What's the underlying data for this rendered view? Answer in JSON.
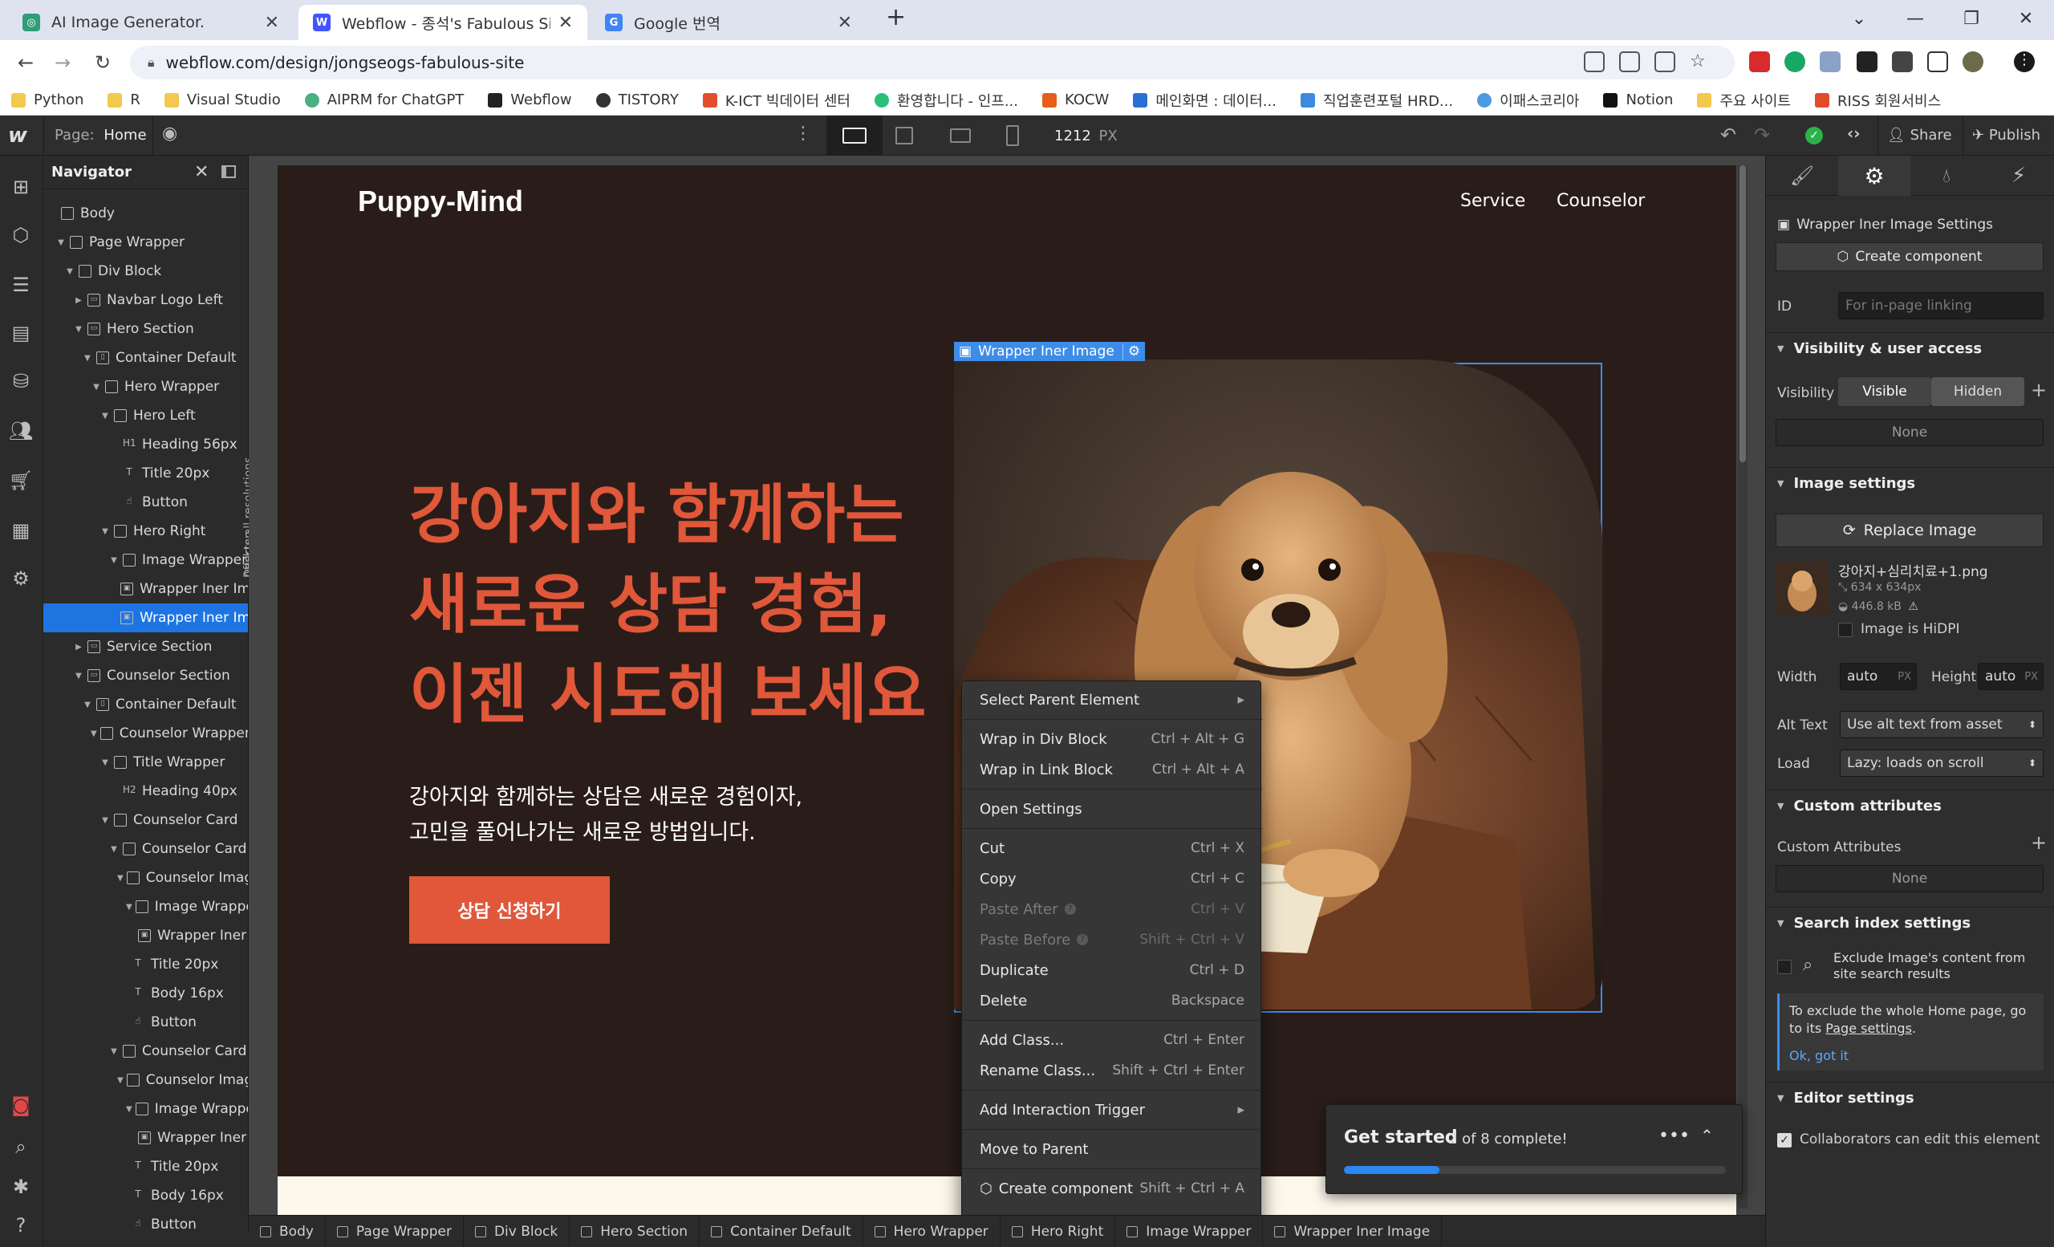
{
  "browser": {
    "tabs": [
      {
        "title": "AI Image Generator.",
        "icon_color": "#2f9e77",
        "active": false
      },
      {
        "title": "Webflow - 종석's Fabulous Site",
        "icon_color": "#4353ff",
        "active": true
      },
      {
        "title": "Google 번역",
        "icon_color": "#4285f4",
        "active": false
      }
    ],
    "url": "webflow.com/design/jongseogs-fabulous-site",
    "bookmarks": [
      "Python",
      "R",
      "Visual Studio",
      "AIPRM for ChatGPT",
      "Webflow",
      "TISTORY",
      "K-ICT 빅데이터 센터",
      "환영합니다 - 인프...",
      "KOCW",
      "메인화면 : 데이터...",
      "직업훈련포털 HRD...",
      "이패스코리아",
      "Notion",
      "주요 사이트",
      "RISS 회원서비스"
    ]
  },
  "wf_topbar": {
    "page_label": "Page:",
    "page_name": "Home",
    "width_value": "1212",
    "width_unit": "PX",
    "share": "Share",
    "publish": "Publish"
  },
  "navigator": {
    "title": "Navigator",
    "rows": [
      {
        "label": "Body",
        "depth": 0,
        "caret": "",
        "icon": "box"
      },
      {
        "label": "Page Wrapper",
        "depth": 1,
        "caret": "down",
        "icon": "box"
      },
      {
        "label": "Div Block",
        "depth": 2,
        "caret": "down",
        "icon": "box"
      },
      {
        "label": "Navbar Logo Left",
        "depth": 3,
        "caret": "right",
        "icon": "section"
      },
      {
        "label": "Hero Section",
        "depth": 3,
        "caret": "down",
        "icon": "section"
      },
      {
        "label": "Container Default",
        "depth": 4,
        "caret": "down",
        "icon": "container"
      },
      {
        "label": "Hero Wrapper",
        "depth": 5,
        "caret": "down",
        "icon": "box"
      },
      {
        "label": "Hero Left",
        "depth": 6,
        "caret": "down",
        "icon": "box"
      },
      {
        "label": "Heading 56px",
        "depth": 7,
        "caret": "",
        "icon": "H1"
      },
      {
        "label": "Title 20px",
        "depth": 7,
        "caret": "",
        "icon": "T"
      },
      {
        "label": "Button",
        "depth": 7,
        "caret": "",
        "icon": "hand"
      },
      {
        "label": "Hero Right",
        "depth": 6,
        "caret": "down",
        "icon": "box"
      },
      {
        "label": "Image Wrapper",
        "depth": 7,
        "caret": "down",
        "icon": "box"
      },
      {
        "label": "Wrapper Iner Image",
        "depth": 8,
        "caret": "",
        "icon": "img"
      },
      {
        "label": "Wrapper Iner Image",
        "depth": 8,
        "caret": "",
        "icon": "img",
        "selected": true
      },
      {
        "label": "Service Section",
        "depth": 3,
        "caret": "right",
        "icon": "section"
      },
      {
        "label": "Counselor Section",
        "depth": 3,
        "caret": "down",
        "icon": "section"
      },
      {
        "label": "Container Default",
        "depth": 4,
        "caret": "down",
        "icon": "container"
      },
      {
        "label": "Counselor Wrapper",
        "depth": 5,
        "caret": "down",
        "icon": "box"
      },
      {
        "label": "Title Wrapper",
        "depth": 6,
        "caret": "down",
        "icon": "box"
      },
      {
        "label": "Heading 40px",
        "depth": 7,
        "caret": "",
        "icon": "H2"
      },
      {
        "label": "Counselor Card",
        "depth": 6,
        "caret": "down",
        "icon": "box"
      },
      {
        "label": "Counselor Card",
        "depth": 7,
        "caret": "down",
        "icon": "box"
      },
      {
        "label": "Counselor Image",
        "depth": 8,
        "caret": "down",
        "icon": "box"
      },
      {
        "label": "Image Wrapper",
        "depth": 9,
        "caret": "down",
        "icon": "box"
      },
      {
        "label": "Wrapper Iner Image",
        "depth": 10,
        "caret": "",
        "icon": "img"
      },
      {
        "label": "Title 20px",
        "depth": 8,
        "caret": "",
        "icon": "T"
      },
      {
        "label": "Body 16px",
        "depth": 8,
        "caret": "",
        "icon": "T"
      },
      {
        "label": "Button",
        "depth": 8,
        "caret": "",
        "icon": "hand"
      },
      {
        "label": "Counselor Card",
        "depth": 7,
        "caret": "down",
        "icon": "box"
      },
      {
        "label": "Counselor Image",
        "depth": 8,
        "caret": "down",
        "icon": "box"
      },
      {
        "label": "Image Wrapper",
        "depth": 9,
        "caret": "down",
        "icon": "box"
      },
      {
        "label": "Wrapper Iner Image",
        "depth": 10,
        "caret": "",
        "icon": "img"
      },
      {
        "label": "Title 20px",
        "depth": 8,
        "caret": "",
        "icon": "T"
      },
      {
        "label": "Body 16px",
        "depth": 8,
        "caret": "",
        "icon": "T"
      },
      {
        "label": "Button",
        "depth": 8,
        "caret": "",
        "icon": "hand"
      }
    ],
    "vertical_note_1": "Affects all resolutions",
    "vertical_note_2": "Desktop"
  },
  "site": {
    "brand": "Puppy-Mind",
    "nav": [
      "Service",
      "Counselor"
    ],
    "hero_heading_lines": [
      "강아지와 함께하는",
      "새로운 상담 경험,",
      "이젠 시도해 보세요"
    ],
    "hero_sub_lines": [
      "강아지와 함께하는 상담은 새로운 경험이자,",
      "고민을 풀어나가는 새로운 방법입니다."
    ],
    "cta": "상담 신청하기",
    "accent": "#e0573a",
    "selected_label": "Wrapper Iner Image"
  },
  "context_menu": {
    "items": [
      {
        "label": "Select Parent Element",
        "shortcut": "",
        "submenu": true
      },
      {
        "sep": true
      },
      {
        "label": "Wrap in Div Block",
        "shortcut": "Ctrl + Alt + G"
      },
      {
        "label": "Wrap in Link Block",
        "shortcut": "Ctrl + Alt + A"
      },
      {
        "sep": true
      },
      {
        "label": "Open Settings",
        "shortcut": ""
      },
      {
        "sep": true
      },
      {
        "label": "Cut",
        "shortcut": "Ctrl + X"
      },
      {
        "label": "Copy",
        "shortcut": "Ctrl + C"
      },
      {
        "label": "Paste After",
        "shortcut": "Ctrl + V",
        "disabled": true,
        "help": true
      },
      {
        "label": "Paste Before",
        "shortcut": "Shift + Ctrl + V",
        "disabled": true,
        "help": true
      },
      {
        "label": "Duplicate",
        "shortcut": "Ctrl + D"
      },
      {
        "label": "Delete",
        "shortcut": "Backspace"
      },
      {
        "sep": true
      },
      {
        "label": "Add Class...",
        "shortcut": "Ctrl + Enter"
      },
      {
        "label": "Rename Class...",
        "shortcut": "Shift + Ctrl + Enter"
      },
      {
        "sep": true
      },
      {
        "label": "Add Interaction Trigger",
        "shortcut": "",
        "submenu": true
      },
      {
        "sep": true
      },
      {
        "label": "Move to Parent",
        "shortcut": ""
      },
      {
        "sep": true
      },
      {
        "label": "Create component",
        "shortcut": "Shift + Ctrl + A",
        "icon": true
      }
    ]
  },
  "get_started": {
    "title": "Get started",
    "progress_text": "2 of 8 complete!",
    "progress": 0.25
  },
  "right_panel": {
    "element_title": "Wrapper Iner Image Settings",
    "create_component": "Create component",
    "id_label": "ID",
    "id_placeholder": "For in-page linking",
    "sec_visibility": "Visibility & user access",
    "visibility_label": "Visibility",
    "visible": "Visible",
    "hidden": "Hidden",
    "none_1": "None",
    "sec_image": "Image settings",
    "replace_image": "Replace Image",
    "file_name": "강아지+심리치료+1.png",
    "file_dims": "634 x 634px",
    "file_size": "446.8 kB",
    "hidpi": "Image is HiDPI",
    "width_label": "Width",
    "width_val": "auto",
    "height_label": "Height",
    "height_val": "auto",
    "px": "PX",
    "alt_label": "Alt Text",
    "alt_val": "Use alt text from asset",
    "load_label": "Load",
    "load_val": "Lazy: loads on scroll",
    "sec_custom": "Custom attributes",
    "custom_label": "Custom Attributes",
    "none_2": "None",
    "sec_search": "Search index settings",
    "exclude_1": "Exclude Image's content from",
    "exclude_2": "site search results",
    "note_1": "To exclude the whole Home page, go",
    "note_2a": "to its ",
    "note_2b": "Page settings",
    "note_2c": ".",
    "ok": "Ok, got it",
    "sec_editor": "Editor settings",
    "collab": "Collaborators can edit this element"
  },
  "breadcrumbs": [
    "Body",
    "Page Wrapper",
    "Div Block",
    "Hero Section",
    "Container Default",
    "Hero Wrapper",
    "Hero Right",
    "Image Wrapper",
    "Wrapper Iner Image"
  ]
}
